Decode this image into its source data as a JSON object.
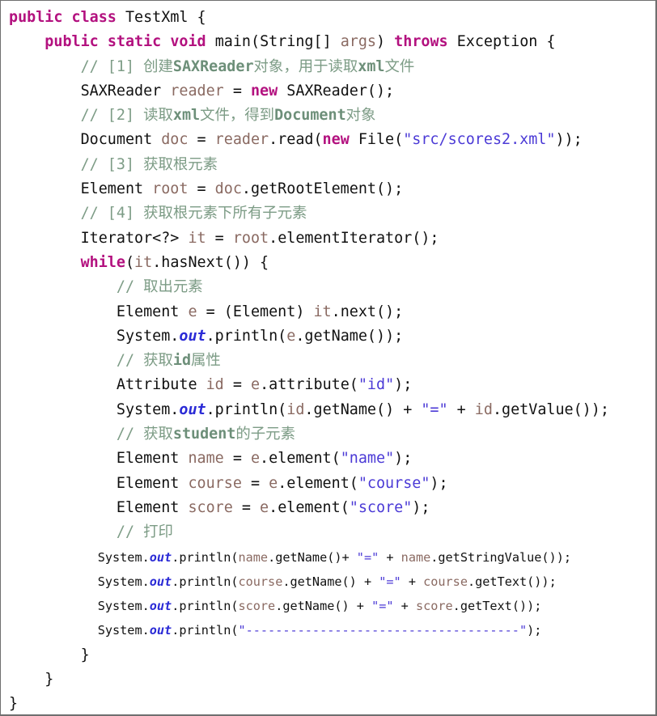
{
  "editor": {
    "language": "java",
    "class_name": "TestXml",
    "border_color": "#6f6f6f",
    "background_color": "#ffffff",
    "colors": {
      "keyword": "#b3117f",
      "string": "#4b3ad6",
      "comment": "#7d9c86",
      "identifier": "#8a6a62",
      "static_field": "#2b2bd6",
      "plain_text": "#111111"
    }
  },
  "code": {
    "line_01": {
      "indent": "",
      "t1": "public ",
      "t2": "class ",
      "t3": "TestXml {"
    },
    "line_02": {
      "indent": "    ",
      "t1": "public ",
      "t2": "static ",
      "t3": "void ",
      "t4": "main(String[] ",
      "t5": "args",
      "t6": ") ",
      "t7": "throws ",
      "t8": "Exception {"
    },
    "line_03": {
      "indent": "        ",
      "t1": "// [1] 创建",
      "t2": "SAXReader",
      "t3": "对象，用于读取",
      "t4": "xml",
      "t5": "文件"
    },
    "line_04": {
      "indent": "        ",
      "t1": "SAXReader ",
      "t2": "reader",
      "t3": " = ",
      "t4": "new ",
      "t5": "SAXReader();"
    },
    "line_05": {
      "indent": "        ",
      "t1": "// [2] 读取",
      "t2": "xml",
      "t3": "文件，得到",
      "t4": "Document",
      "t5": "对象"
    },
    "line_06": {
      "indent": "        ",
      "t1": "Document ",
      "t2": "doc",
      "t3": " = ",
      "t4": "reader",
      "t5": ".read(",
      "t6": "new ",
      "t7": "File(",
      "t8": "\"src/scores2.xml\"",
      "t9": "));"
    },
    "line_07": {
      "indent": "        ",
      "t1": "// [3] 获取根元素"
    },
    "line_08": {
      "indent": "        ",
      "t1": "Element ",
      "t2": "root",
      "t3": " = ",
      "t4": "doc",
      "t5": ".getRootElement();"
    },
    "line_09": {
      "indent": "        ",
      "t1": "// [4] 获取根元素下所有子元素"
    },
    "line_10": {
      "indent": "        ",
      "t1": "Iterator<?> ",
      "t2": "it",
      "t3": " = ",
      "t4": "root",
      "t5": ".elementIterator();"
    },
    "line_11": {
      "indent": "        ",
      "t1": "while",
      "t2": "(",
      "t3": "it",
      "t4": ".hasNext()) {"
    },
    "line_12": {
      "indent": "            ",
      "t1": "// 取出元素"
    },
    "line_13": {
      "indent": "            ",
      "t1": "Element ",
      "t2": "e",
      "t3": " = (Element) ",
      "t4": "it",
      "t5": ".next();"
    },
    "line_14": {
      "indent": "            ",
      "t1": "System.",
      "t2": "out",
      "t3": ".println(",
      "t4": "e",
      "t5": ".getName());"
    },
    "line_15": {
      "indent": "            ",
      "t1": "// 获取",
      "t2": "id",
      "t3": "属性"
    },
    "line_16": {
      "indent": "            ",
      "t1": "Attribute ",
      "t2": "id",
      "t3": " = ",
      "t4": "e",
      "t5": ".attribute(",
      "t6": "\"id\"",
      "t7": ");"
    },
    "line_17": {
      "indent": "            ",
      "t1": "System.",
      "t2": "out",
      "t3": ".println(",
      "t4": "id",
      "t5": ".getName() + ",
      "t6": "\"=\"",
      "t7": " + ",
      "t8": "id",
      "t9": ".getValue());"
    },
    "line_18": {
      "indent": "            ",
      "t1": "// 获取",
      "t2": "student",
      "t3": "的子元素"
    },
    "line_19": {
      "indent": "            ",
      "t1": "Element ",
      "t2": "name",
      "t3": " = ",
      "t4": "e",
      "t5": ".element(",
      "t6": "\"name\"",
      "t7": ");"
    },
    "line_20": {
      "indent": "            ",
      "t1": "Element ",
      "t2": "course",
      "t3": " = ",
      "t4": "e",
      "t5": ".element(",
      "t6": "\"course\"",
      "t7": ");"
    },
    "line_21": {
      "indent": "            ",
      "t1": "Element ",
      "t2": "score",
      "t3": " = ",
      "t4": "e",
      "t5": ".element(",
      "t6": "\"score\"",
      "t7": ");"
    },
    "line_22": {
      "indent": "            ",
      "t1": "// 打印"
    },
    "line_23": {
      "indent": "            ",
      "t1": "System.",
      "t2": "out",
      "t3": ".println(",
      "t4": "name",
      "t5": ".getName()+ ",
      "t6": "\"=\"",
      "t7": " + ",
      "t8": "name",
      "t9": ".getStringValue());"
    },
    "line_24": {
      "indent": "            ",
      "t1": "System.",
      "t2": "out",
      "t3": ".println(",
      "t4": "course",
      "t5": ".getName() + ",
      "t6": "\"=\"",
      "t7": " + ",
      "t8": "course",
      "t9": ".getText());"
    },
    "line_25": {
      "indent": "            ",
      "t1": "System.",
      "t2": "out",
      "t3": ".println(",
      "t4": "score",
      "t5": ".getName() + ",
      "t6": "\"=\"",
      "t7": " + ",
      "t8": "score",
      "t9": ".getText());"
    },
    "line_26": {
      "indent": "            ",
      "t1": "System.",
      "t2": "out",
      "t3": ".println(",
      "t4": "\"-------------------------------------\"",
      "t5": ");"
    },
    "line_27": {
      "indent": "        ",
      "t1": "}"
    },
    "line_28": {
      "indent": "    ",
      "t1": "}"
    },
    "line_29": {
      "indent": "",
      "t1": "}"
    }
  }
}
